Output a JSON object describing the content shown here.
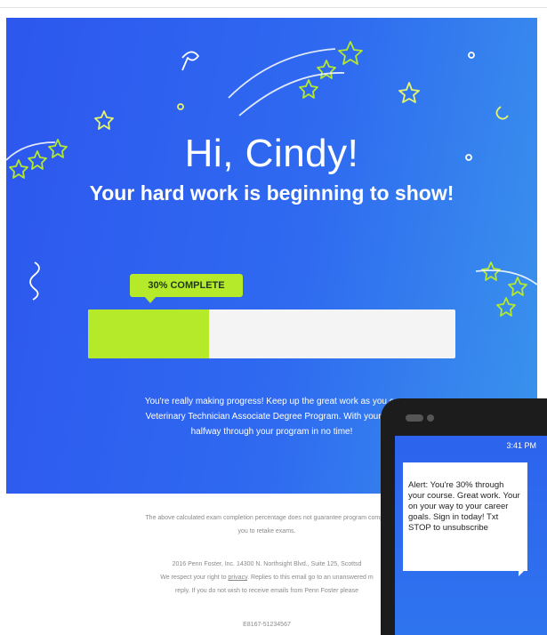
{
  "hero": {
    "greeting": "Hi, Cindy!",
    "subtitle": "Your hard work is beginning to show!",
    "badge": "30% COMPLETE",
    "progress": 0.33,
    "body_line1": "You're really making progress! Keep up the great work as you co",
    "body_line2": "Veterinary Technician Associate Degree Program. With your con",
    "body_line3": "halfway through your program in no time!",
    "colors": {
      "accent": "#b4ea2a",
      "hero_bg": "#2f6af0"
    }
  },
  "footer": {
    "disclaimer_line1": "The above calculated exam completion percentage does not guarantee program comple",
    "disclaimer_line2": "you to retake exams.",
    "address": "2016 Penn Foster, Inc. 14300 N. Northsight Blvd., Suite 125, Scottsd",
    "privacy_prefix": "We respect your right to ",
    "privacy_link": "privacy",
    "privacy_suffix": ". Replies to this email go to an unanswered m",
    "unsubscribe_text": "reply. If you do not wish to receive emails from Penn Foster please",
    "code": "E8167-51234567"
  },
  "phone": {
    "time": "3:41 PM",
    "sms": "Alert: You're 30% through your course. Great work. Your on your way to your career goals. Sign in today! Txt STOP to unsubscribe"
  }
}
